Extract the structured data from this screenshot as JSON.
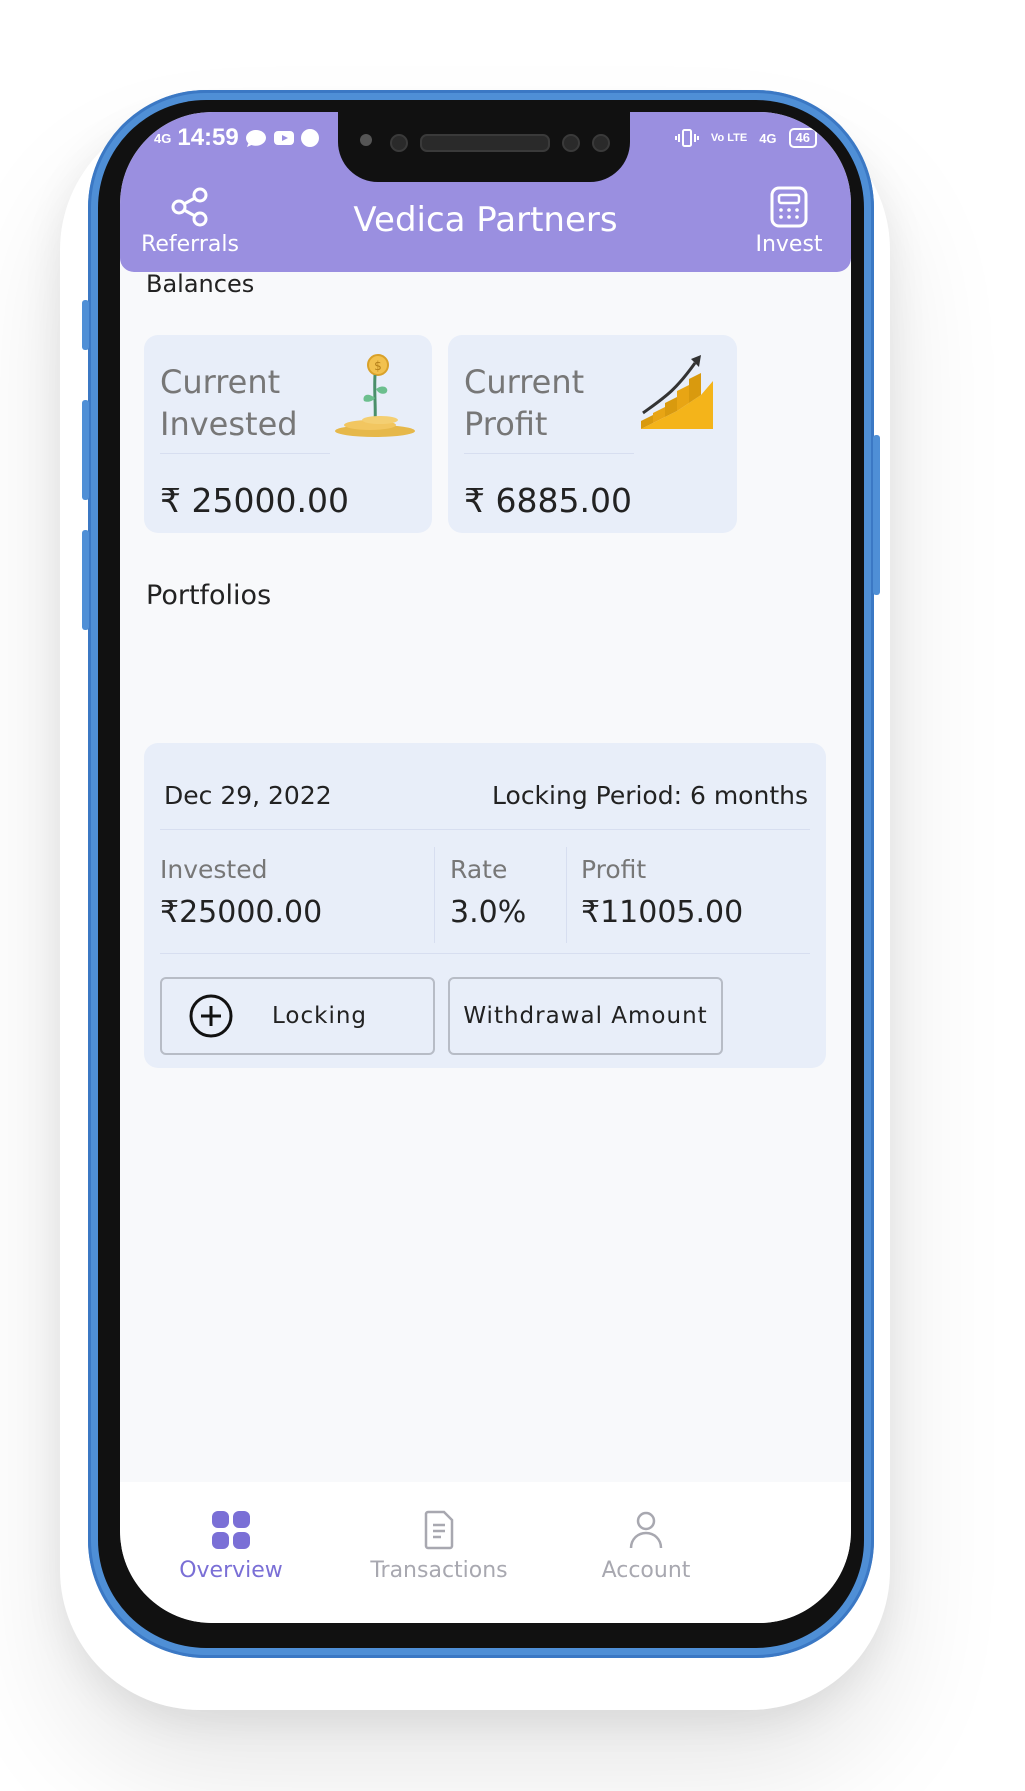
{
  "status_bar": {
    "signal": "4G",
    "time": "14:59",
    "right_icons": [
      "vibrate-icon",
      "volte-icon",
      "4g-icon"
    ],
    "network_right": "4G",
    "volte": "Vo LTE",
    "battery": "46"
  },
  "header": {
    "title": "Vedica Partners",
    "left_button": {
      "label": "Referrals",
      "icon": "share-icon"
    },
    "right_button": {
      "label": "Invest",
      "icon": "calculator-icon"
    }
  },
  "balances": {
    "section_title": "Balances",
    "cards": [
      {
        "label_line1": "Current",
        "label_line2": "Invested",
        "value": "₹ 25000.00",
        "icon": "money-plant-icon"
      },
      {
        "label_line1": "Current",
        "label_line2": "Profit",
        "value": "₹ 6885.00",
        "icon": "growth-chart-icon"
      }
    ]
  },
  "portfolios": {
    "section_title": "Portfolios",
    "items": [
      {
        "date": "Dec 29, 2022",
        "locking_period": "Locking Period: 6 months",
        "invested_label": "Invested",
        "invested_value": "₹25000.00",
        "rate_label": "Rate",
        "rate_value": "3.0%",
        "profit_label": "Profit",
        "profit_value": "₹11005.00",
        "locking_button": "Locking",
        "withdraw_button": "Withdrawal Amount"
      }
    ]
  },
  "bottom_nav": {
    "items": [
      {
        "label": "Overview",
        "icon": "grid-icon",
        "active": true
      },
      {
        "label": "Transactions",
        "icon": "document-icon",
        "active": false
      },
      {
        "label": "Account",
        "icon": "person-icon",
        "active": false
      }
    ]
  },
  "colors": {
    "accent": "#9a8fe0",
    "active_nav": "#7a6fd6",
    "inactive_nav": "#a8a8b0",
    "card_bg": "#e8eef9",
    "frame": "#4f8fd6"
  }
}
